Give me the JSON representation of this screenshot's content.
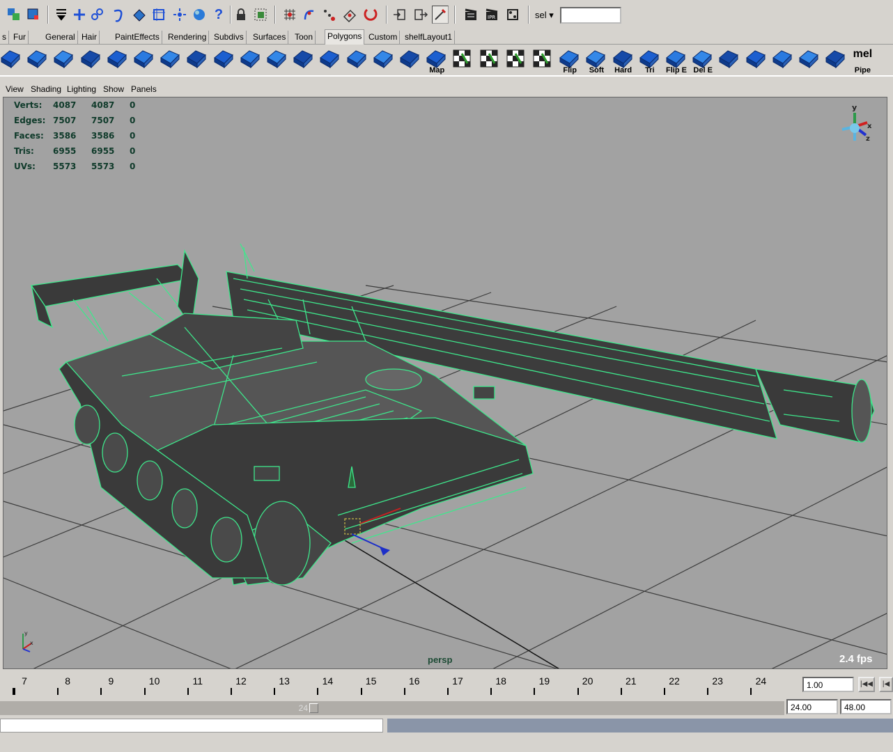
{
  "toolbar": {
    "icons": [
      "select-by-hierarchy-icon",
      "select-by-object-icon",
      "menu-set-icon",
      "snap-grid-icon",
      "snap-curve-icon",
      "snap-point-icon",
      "snap-plane-icon",
      "live-surface-icon",
      "history-icon",
      "help-icon",
      "lock-icon",
      "camera-icon",
      "ipr-icon",
      "render-icon",
      "magnet-icon"
    ],
    "sel_label": "sel",
    "sel_value": ""
  },
  "shelf_tabs": [
    {
      "label": "s"
    },
    {
      "label": "Fur"
    },
    {
      "label": "General"
    },
    {
      "label": "Hair"
    },
    {
      "label": "PaintEffects"
    },
    {
      "label": "Rendering"
    },
    {
      "label": "Subdivs"
    },
    {
      "label": "Surfaces"
    },
    {
      "label": "Toon"
    },
    {
      "label": "Polygons",
      "active": true
    },
    {
      "label": "Custom"
    },
    {
      "label": "shelfLayout1"
    }
  ],
  "shelf_items": [
    {
      "name": "sphere"
    },
    {
      "name": "cube"
    },
    {
      "name": "cylinder"
    },
    {
      "name": "split-poly"
    },
    {
      "name": "extrude"
    },
    {
      "name": "bevel"
    },
    {
      "name": "merge"
    },
    {
      "name": "bridge"
    },
    {
      "name": "append"
    },
    {
      "name": "wedge"
    },
    {
      "name": "poke"
    },
    {
      "name": "smooth"
    },
    {
      "name": "chamfer"
    },
    {
      "name": "slide"
    },
    {
      "name": "planar"
    },
    {
      "name": "cylindrical"
    },
    {
      "name": "automatic-map",
      "label": "Map"
    },
    {
      "name": "uv-editor"
    },
    {
      "name": "layout-uv"
    },
    {
      "name": "checker"
    },
    {
      "name": "snapshot"
    },
    {
      "name": "flip",
      "label": "Flip"
    },
    {
      "name": "soften",
      "label": "Soft"
    },
    {
      "name": "harden",
      "label": "Hard"
    },
    {
      "name": "triangulate",
      "label": "Tri"
    },
    {
      "name": "flip-edge",
      "label": "Flip E"
    },
    {
      "name": "delete-edge",
      "label": "Del E"
    },
    {
      "name": "reduce"
    },
    {
      "name": "cleanup-checker"
    },
    {
      "name": "transfer-checker"
    },
    {
      "name": "color-set"
    },
    {
      "name": "paint-texture"
    },
    {
      "name": "pipe",
      "top": "mel",
      "label": "Pipe"
    }
  ],
  "panel_menu": [
    "View",
    "Shading",
    "Lighting",
    "Show",
    "Panels"
  ],
  "hud": {
    "rows": [
      {
        "label": "Verts:",
        "a": "4087",
        "b": "4087",
        "c": "0"
      },
      {
        "label": "Edges:",
        "a": "7507",
        "b": "7507",
        "c": "0"
      },
      {
        "label": "Faces:",
        "a": "3586",
        "b": "3586",
        "c": "0"
      },
      {
        "label": "Tris:",
        "a": "6955",
        "b": "6955",
        "c": "0"
      },
      {
        "label": "UVs:",
        "a": "5573",
        "b": "5573",
        "c": "0"
      }
    ]
  },
  "viewport": {
    "camera": "persp",
    "fps": "2.4 fps",
    "wire_color": "#3ee88c",
    "bg_color": "#a2a2a2"
  },
  "timeline": {
    "ticks": [
      "7",
      "8",
      "9",
      "10",
      "11",
      "12",
      "13",
      "14",
      "15",
      "16",
      "17",
      "18",
      "19",
      "20",
      "21",
      "22",
      "23",
      "24"
    ],
    "current_time": "1.00",
    "range_handle_label": "24",
    "range_end": "24.00",
    "playback_end": "48.00"
  }
}
